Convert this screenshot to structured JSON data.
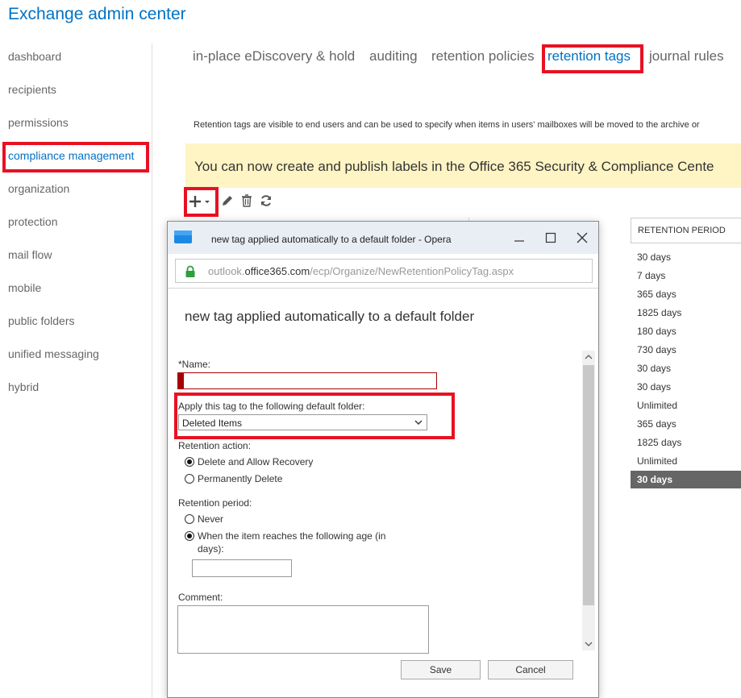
{
  "app": {
    "title": "Exchange admin center"
  },
  "sidebar": {
    "items": [
      {
        "label": "dashboard"
      },
      {
        "label": "recipients"
      },
      {
        "label": "permissions"
      },
      {
        "label": "compliance management"
      },
      {
        "label": "organization"
      },
      {
        "label": "protection"
      },
      {
        "label": "mail flow"
      },
      {
        "label": "mobile"
      },
      {
        "label": "public folders"
      },
      {
        "label": "unified messaging"
      },
      {
        "label": "hybrid"
      }
    ],
    "active": "compliance management"
  },
  "tabs": [
    {
      "label": "in-place eDiscovery & hold"
    },
    {
      "label": "auditing"
    },
    {
      "label": "retention policies"
    },
    {
      "label": "retention tags"
    },
    {
      "label": "journal rules"
    }
  ],
  "main": {
    "description": "Retention tags are visible to end users and can be used to specify when items in users' mailboxes will be moved to the archive or",
    "banner": "You can now create and publish labels in the Office 365 Security & Compliance Cente",
    "toolbar": {
      "add_icon": "plus-icon",
      "edit_icon": "pencil-icon",
      "delete_icon": "trash-icon",
      "refresh_icon": "refresh-icon"
    },
    "table": {
      "retention_period_header": "RETENTION PERIOD",
      "retention_periods": [
        "30 days",
        "7 days",
        "365 days",
        "1825 days",
        "180 days",
        "730 days",
        "30 days",
        "30 days",
        "Unlimited",
        "365 days",
        "1825 days",
        "Unlimited",
        "30 days"
      ],
      "selected_index": 12
    }
  },
  "dialog": {
    "window_title": "new tag applied automatically to a default folder - Opera",
    "address": {
      "scheme": "outlook.",
      "host": "office365.com",
      "path": "/ecp/Organize/NewRetentionPolicyTag.aspx"
    },
    "form_title": "new tag applied automatically to a default folder",
    "name_label": "*Name:",
    "name_value": "",
    "folder_label": "Apply this tag to the following default folder:",
    "folder_value": "Deleted Items",
    "retention_action_label": "Retention action:",
    "action_options": [
      "Delete and Allow Recovery",
      "Permanently Delete"
    ],
    "retention_period_label": "Retention period:",
    "period_never": "Never",
    "period_age_line1": "When the item reaches the following age (in",
    "period_age_line2": "days):",
    "age_value": "",
    "comment_label": "Comment:",
    "comment_value": "",
    "save_label": "Save",
    "cancel_label": "Cancel"
  },
  "colors": {
    "accent": "#0072c6",
    "highlight": "#e81123",
    "banner": "#fff4c4",
    "required": "#a80000"
  }
}
